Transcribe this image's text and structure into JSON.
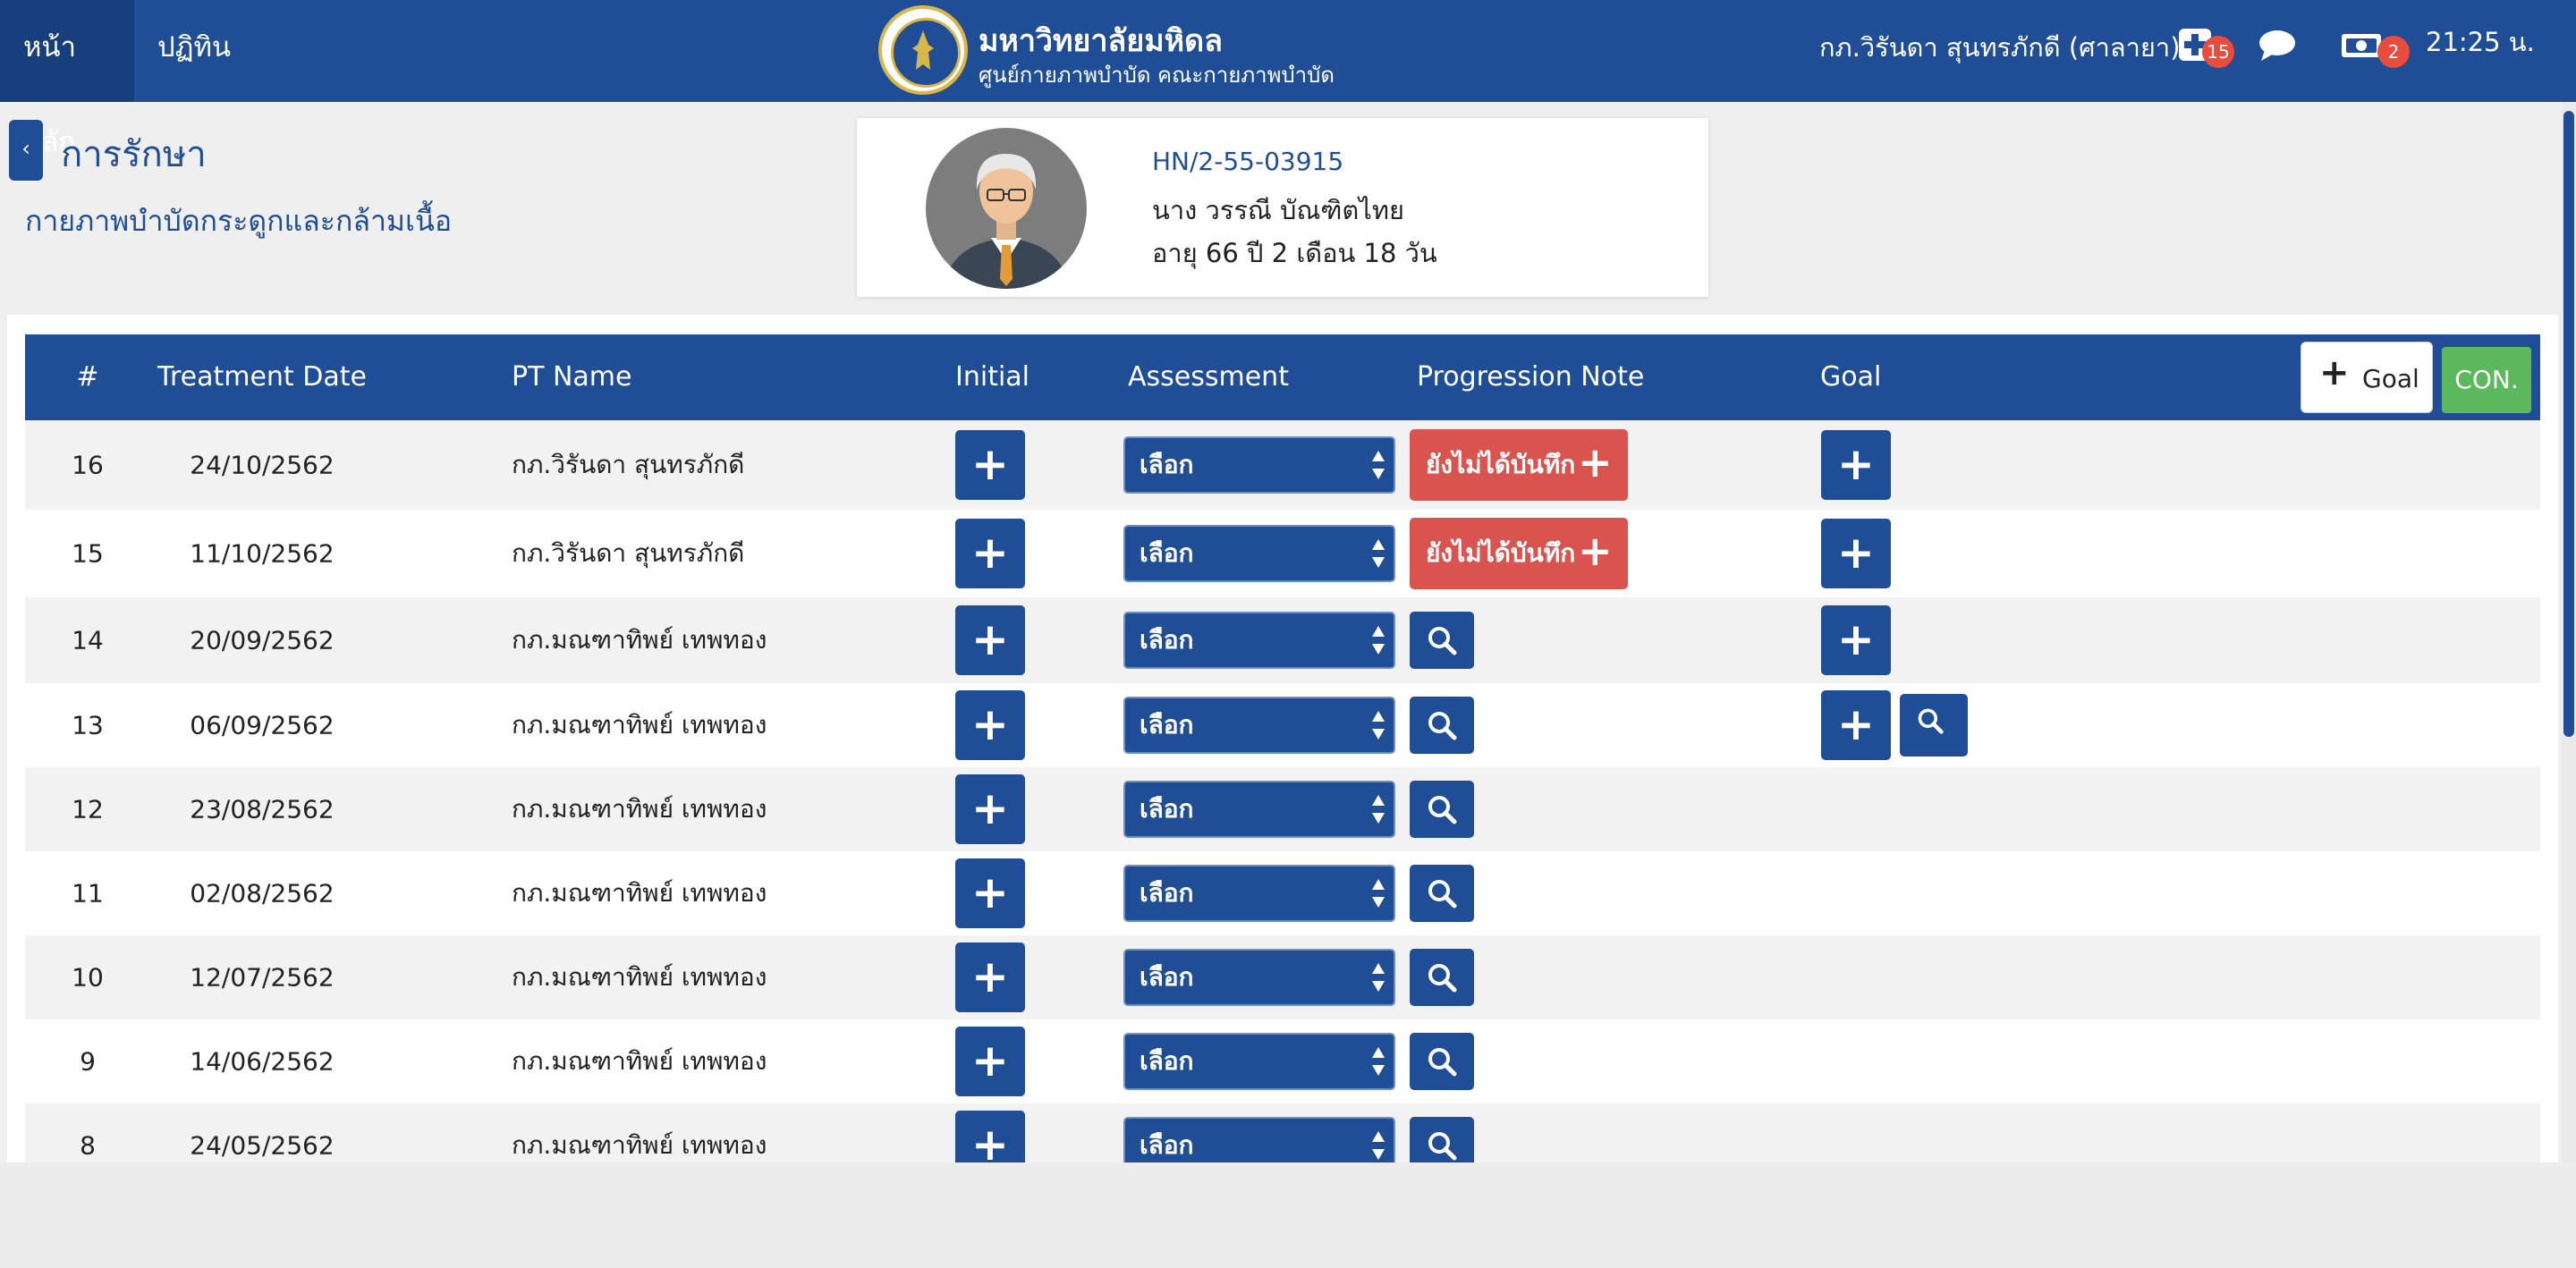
{
  "nav": {
    "home": "หน้าหลัก",
    "calendar": "ปฏิทิน"
  },
  "org": {
    "title": "มหาวิทยาลัยมหิดล",
    "subtitle": "ศูนย์กายภาพบำบัด คณะกายภาพบำบัด"
  },
  "header": {
    "user": "กภ.วิรันดา สุนทรภักดี (ศาลายา)",
    "notif_count": "15",
    "chat_icon": "chat-icon",
    "payment_count": "2",
    "time": "21:25 น."
  },
  "section": {
    "back_label": "‹",
    "title": "การรักษา",
    "subtitle": "กายภาพบำบัดกระดูกและกล้ามเนื้อ"
  },
  "patient": {
    "hn": "HN/2-55-03915",
    "name": "นาง วรรณี บัณฑิตไทย",
    "age": "อายุ 66 ปี 2 เดือน 18 วัน"
  },
  "table": {
    "headers": {
      "num": "#",
      "date": "Treatment Date",
      "pt": "PT Name",
      "initial": "Initial",
      "assessment": "Assessment",
      "progress": "Progression Note",
      "goal": "Goal"
    },
    "goal_button": "Goal",
    "con_button": "CON.",
    "select_label": "เลือก",
    "pending_label": "ยังไม่ได้บันทึก",
    "rows": [
      {
        "num": "16",
        "date": "24/10/2562",
        "pt": "กภ.วิรันดา สุนทรภักดี",
        "progress": "pending",
        "goal": [
          "add"
        ]
      },
      {
        "num": "15",
        "date": "11/10/2562",
        "pt": "กภ.วิรันดา สุนทรภักดี",
        "progress": "pending",
        "goal": [
          "add"
        ]
      },
      {
        "num": "14",
        "date": "20/09/2562",
        "pt": "กภ.มณฑาทิพย์ เทพทอง",
        "progress": "view",
        "goal": [
          "add"
        ]
      },
      {
        "num": "13",
        "date": "06/09/2562",
        "pt": "กภ.มณฑาทิพย์ เทพทอง",
        "progress": "view",
        "goal": [
          "add",
          "view"
        ]
      },
      {
        "num": "12",
        "date": "23/08/2562",
        "pt": "กภ.มณฑาทิพย์ เทพทอง",
        "progress": "view",
        "goal": []
      },
      {
        "num": "11",
        "date": "02/08/2562",
        "pt": "กภ.มณฑาทิพย์ เทพทอง",
        "progress": "view",
        "goal": []
      },
      {
        "num": "10",
        "date": "12/07/2562",
        "pt": "กภ.มณฑาทิพย์ เทพทอง",
        "progress": "view",
        "goal": []
      },
      {
        "num": "9",
        "date": "14/06/2562",
        "pt": "กภ.มณฑาทิพย์ เทพทอง",
        "progress": "view",
        "goal": []
      },
      {
        "num": "8",
        "date": "24/05/2562",
        "pt": "กภ.มณฑาทิพย์ เทพทอง",
        "progress": "view",
        "goal": []
      }
    ]
  },
  "colors": {
    "primary": "#1f4e96",
    "danger": "#d9534f",
    "success": "#5cb85c",
    "badge": "#e74c3c"
  }
}
